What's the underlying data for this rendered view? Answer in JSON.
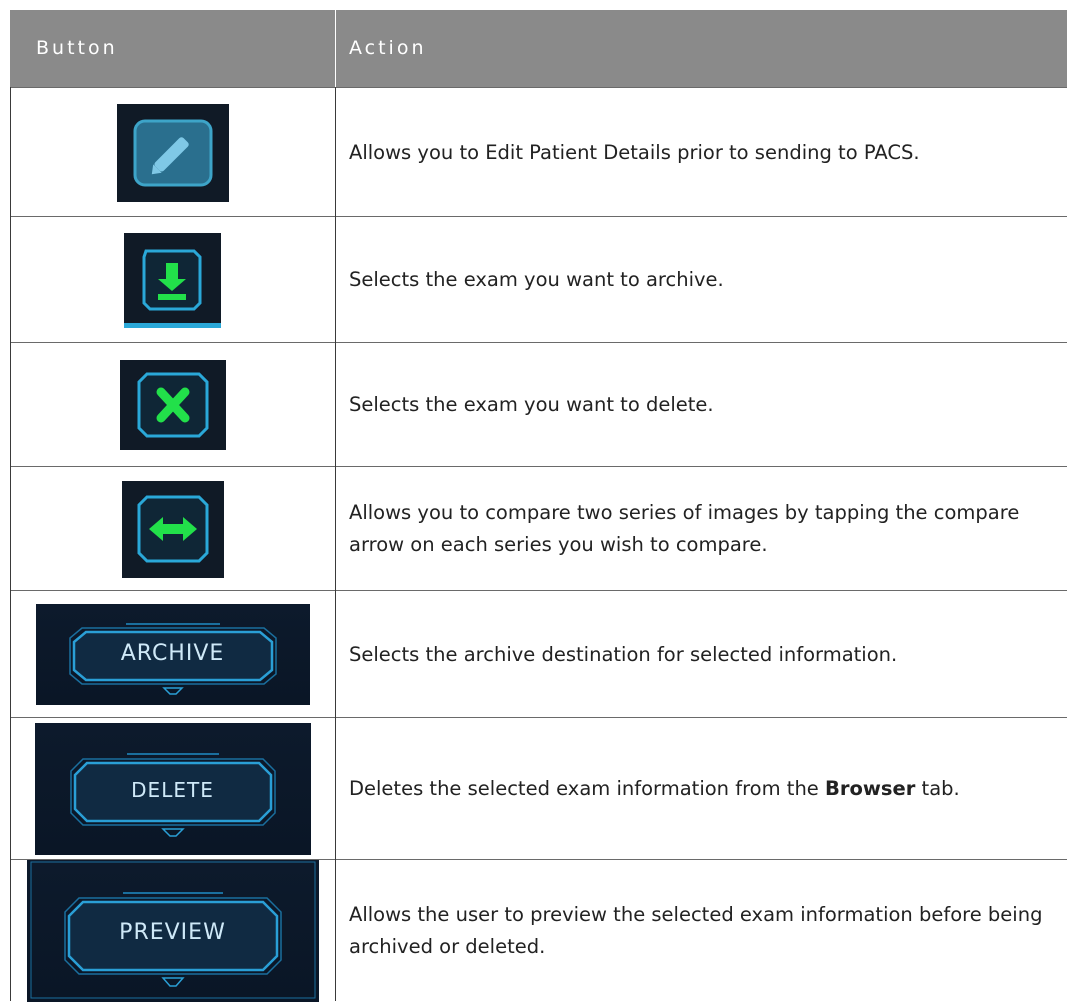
{
  "table": {
    "headers": [
      "Button",
      "Action"
    ],
    "rows": [
      {
        "button_icon": "edit-pencil-icon",
        "action": "Allows you to Edit Patient Details prior to sending to PACS."
      },
      {
        "button_icon": "archive-download-icon",
        "action": "Selects the exam you want to archive."
      },
      {
        "button_icon": "delete-x-icon",
        "action": "Selects the exam you want to delete."
      },
      {
        "button_icon": "compare-arrows-icon",
        "action": "Allows you to compare two series of images by tapping the compare arrow on each series you wish to compare."
      },
      {
        "button_label": "ARCHIVE",
        "action": "Selects the archive destination for selected information."
      },
      {
        "button_label": "DELETE",
        "action_pre": "Deletes the selected exam information from the ",
        "action_bold": "Browser",
        "action_post": " tab."
      },
      {
        "button_label": "PREVIEW",
        "action": "Allows the user to preview the selected exam information before being archived or deleted."
      }
    ]
  },
  "colors": {
    "header_bg": "#8a8a8a",
    "icon_green": "#22e04a",
    "icon_frame": "#2aa8d8",
    "button_bg": "#0c1828"
  }
}
